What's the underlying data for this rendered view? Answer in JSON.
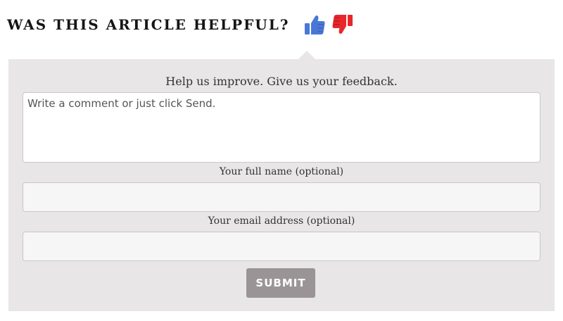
{
  "header": {
    "title": "WAS THIS ARTICLE HELPFUL?",
    "thumbs_up_icon": "thumbs-up-icon",
    "thumbs_down_icon": "thumbs-down-icon",
    "colors": {
      "thumbs_up": "#4a78d6",
      "thumbs_down": "#e8262b"
    }
  },
  "form": {
    "prompt": "Help us improve. Give us your feedback.",
    "comment_placeholder": "Write a comment or just click Send.",
    "name_label": "Your full name (optional)",
    "name_value": "",
    "email_label": "Your email address (optional)",
    "email_value": "",
    "submit_label": "SUBMIT",
    "colors": {
      "panel_bg": "#e8e6e6",
      "submit_bg": "#9b9496"
    }
  }
}
